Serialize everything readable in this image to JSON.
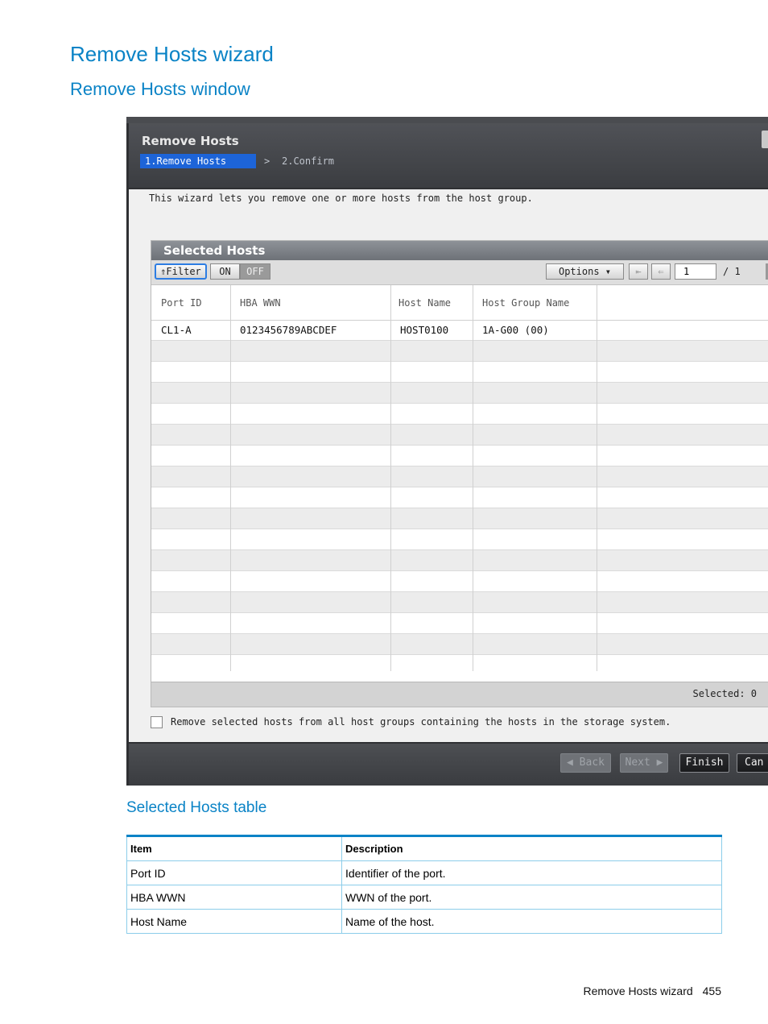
{
  "doc": {
    "title": "Remove Hosts wizard",
    "section": "Remove Hosts window",
    "table_caption": "Selected Hosts table",
    "footer_text": "Remove Hosts wizard",
    "page_number": "455"
  },
  "dialog": {
    "title": "Remove Hosts",
    "steps": {
      "active": "1.Remove Hosts",
      "separator": ">",
      "next": "2.Confirm"
    },
    "intro": "This wizard lets you remove one or more hosts from the host group.",
    "panel_title": "Selected Hosts",
    "toolbar": {
      "filter": "⇑Filter",
      "on": "ON",
      "off": "OFF",
      "options": "Options ▾",
      "first": "⇤",
      "prev": "⇐",
      "page_value": "1",
      "page_total": "/ 1"
    },
    "columns": [
      "Port ID",
      "HBA WWN",
      "Host Name",
      "Host Group Name"
    ],
    "rows": [
      [
        "CL1-A",
        "0123456789ABCDEF",
        "HOST0100",
        "1A-G00 (00)"
      ]
    ],
    "selected_label": "Selected: 0",
    "checkbox_label": "Remove selected hosts from all host groups containing the hosts in the storage system.",
    "buttons": {
      "back": "◀ Back",
      "next": "Next ▶",
      "finish": "Finish",
      "cancel": "Can"
    }
  },
  "table": {
    "headers": [
      "Item",
      "Description"
    ],
    "rows": [
      [
        "Port ID",
        "Identifier of the port."
      ],
      [
        "HBA WWN",
        "WWN of the port."
      ],
      [
        "Host Name",
        "Name of the host."
      ]
    ]
  }
}
